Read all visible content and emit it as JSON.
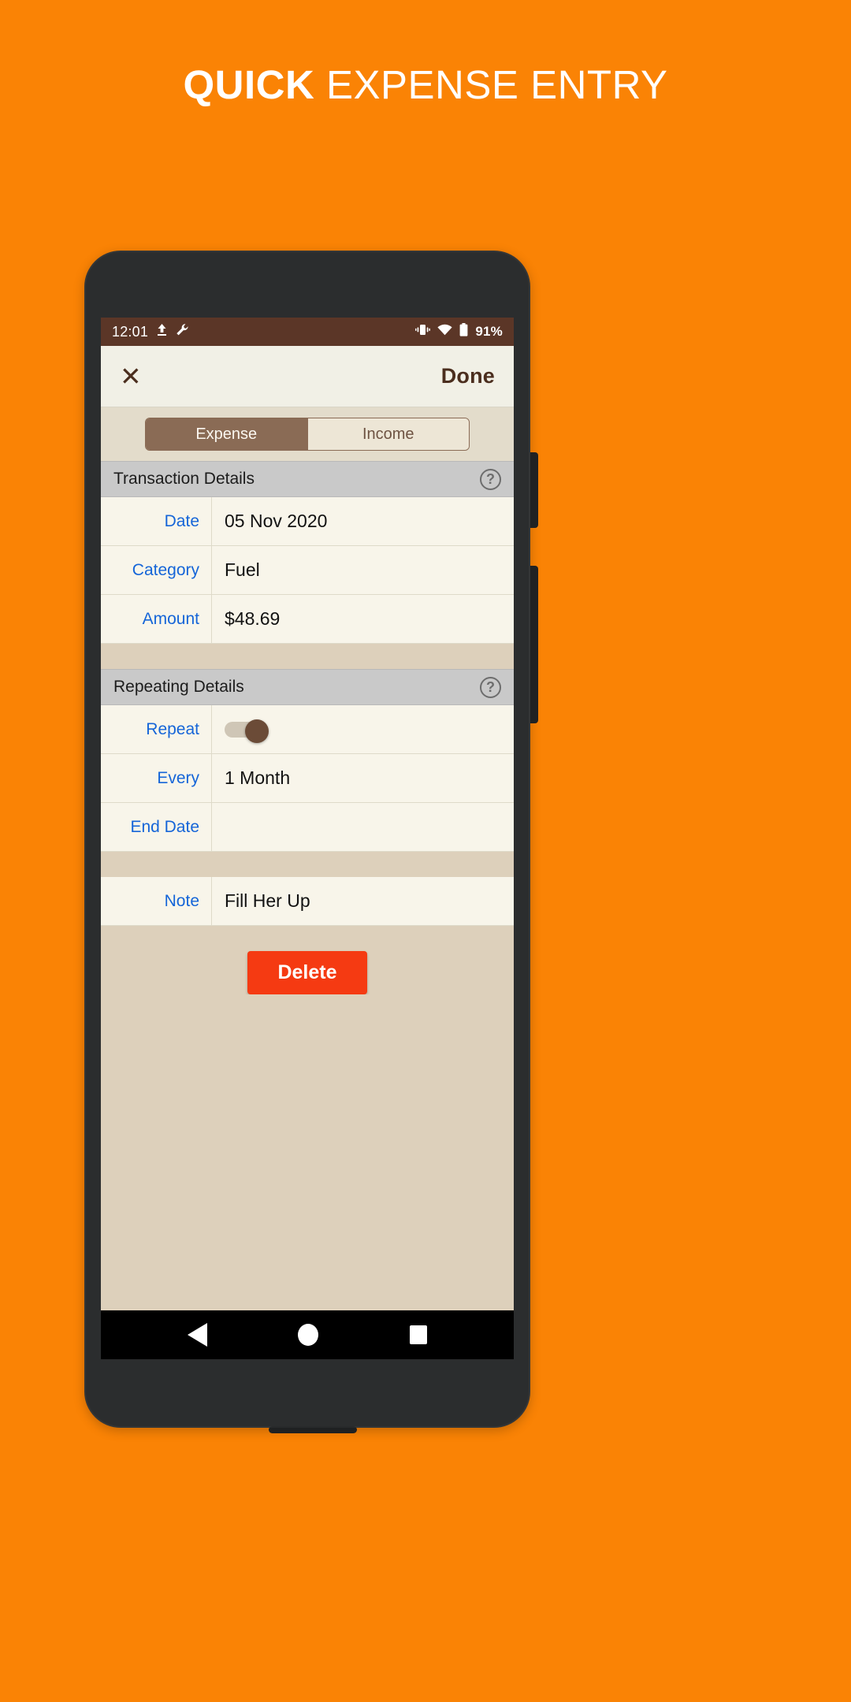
{
  "promo": {
    "title_bold": "QUICK",
    "title_light": " EXPENSE ENTRY",
    "background_color": "#FA8305"
  },
  "status_bar": {
    "clock": "12:01",
    "left_icons": [
      "upload-icon",
      "wrench-icon"
    ],
    "right_icons": [
      "vibrate-icon",
      "wifi-icon",
      "battery-icon"
    ],
    "battery_percent": "91%",
    "background_color": "#5B3627"
  },
  "toolbar": {
    "close_label": "✕",
    "done_label": "Done"
  },
  "segmented_control": {
    "options": [
      {
        "label": "Expense",
        "selected": true
      },
      {
        "label": "Income",
        "selected": false
      }
    ],
    "active_color": "#8A6B55"
  },
  "sections": [
    {
      "title": "Transaction Details",
      "help_icon": "question-mark-icon",
      "help_label": "?",
      "rows": [
        {
          "label": "Date",
          "value": "05 Nov 2020"
        },
        {
          "label": "Category",
          "value": "Fuel"
        },
        {
          "label": "Amount",
          "value": "$48.69"
        }
      ]
    },
    {
      "title": "Repeating Details",
      "help_icon": "question-mark-icon",
      "help_label": "?",
      "rows": [
        {
          "label": "Repeat",
          "value": "",
          "control": "toggle",
          "toggle_on": true
        },
        {
          "label": "Every",
          "value": "1 Month"
        },
        {
          "label": "End Date",
          "value": ""
        }
      ]
    }
  ],
  "note_row": {
    "label": "Note",
    "value": "Fill Her Up"
  },
  "delete_button": {
    "label": "Delete",
    "color": "#F53A12"
  },
  "nav_bar": {
    "back_icon": "back-triangle-icon",
    "home_icon": "home-circle-icon",
    "recents_icon": "recents-square-icon"
  },
  "colors": {
    "row_background": "#F8F5EA",
    "label_blue": "#1565D8",
    "page_background": "#DDD0BB",
    "section_header": "#C9C9C9"
  }
}
